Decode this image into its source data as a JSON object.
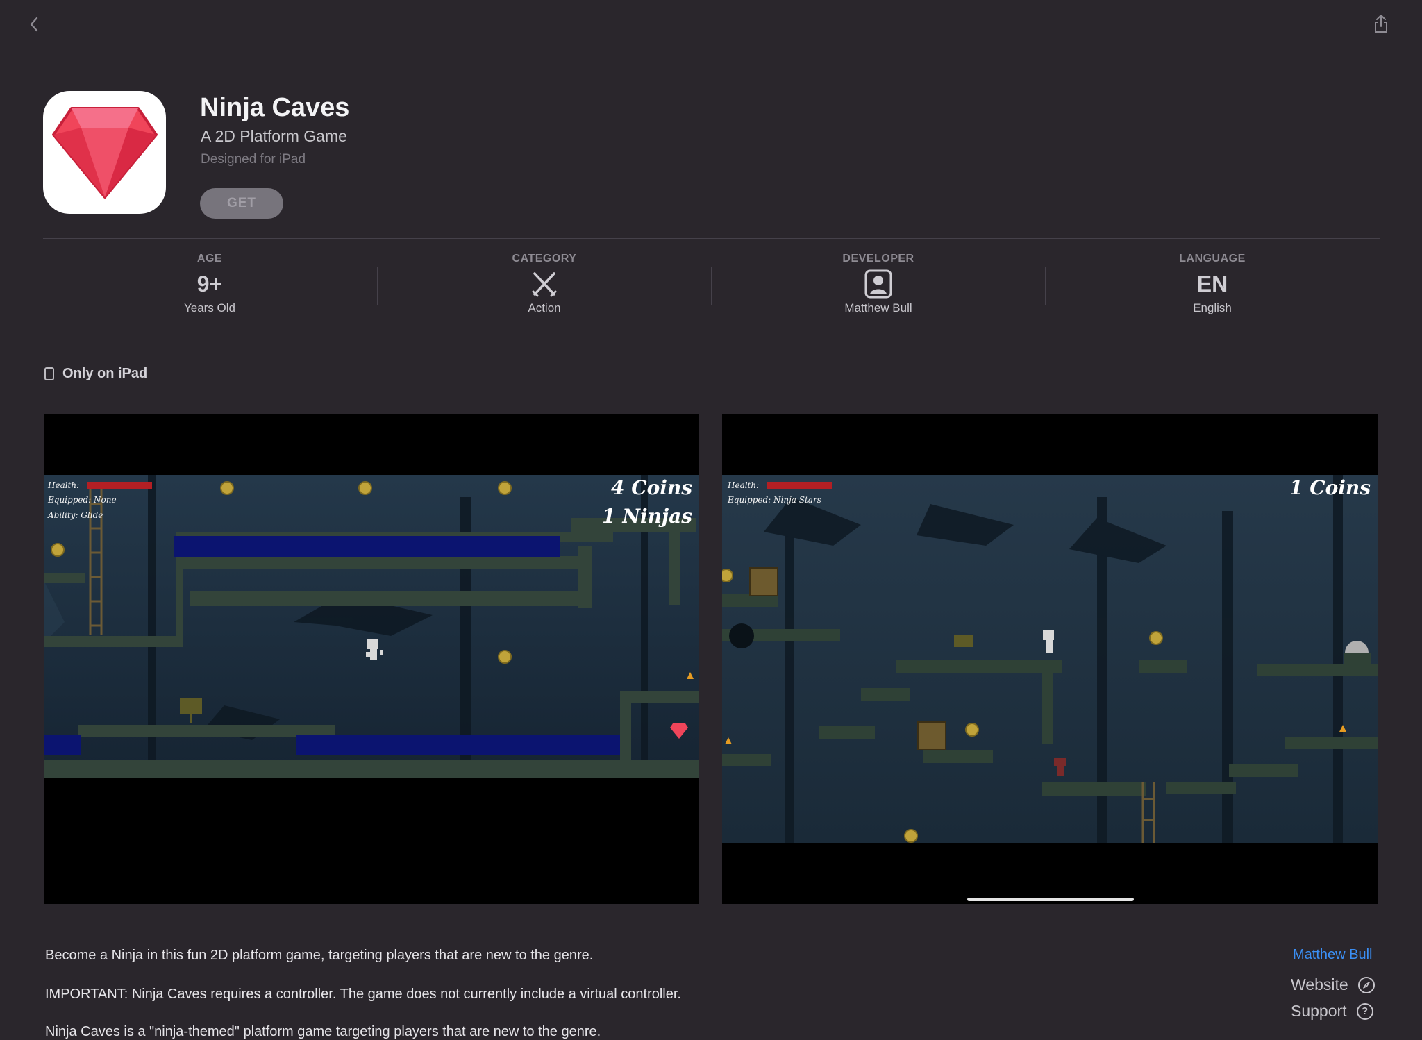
{
  "app": {
    "title": "Ninja Caves",
    "subtitle": "A 2D Platform Game",
    "designed_for": "Designed for iPad",
    "get_label": "GET"
  },
  "info": [
    {
      "label": "AGE",
      "value": "9+",
      "sub": "Years Old"
    },
    {
      "label": "CATEGORY",
      "icon": "swords-icon",
      "sub": "Action"
    },
    {
      "label": "DEVELOPER",
      "icon": "person-icon",
      "sub": "Matthew Bull"
    },
    {
      "label": "LANGUAGE",
      "value": "EN",
      "sub": "English"
    }
  ],
  "only_ipad": "Only on iPad",
  "screenshots": [
    {
      "hud": [
        "Health:",
        "Equipped: None",
        "Ability: Glide"
      ],
      "counters": [
        "4 Coins",
        "1 Ninjas"
      ]
    },
    {
      "hud": [
        "Health:",
        "Equipped: Ninja Stars"
      ],
      "counters": [
        "1 Coins"
      ]
    }
  ],
  "description": [
    "Become a Ninja in this fun 2D platform game, targeting players that are new to the genre.",
    "IMPORTANT: Ninja Caves requires a controller. The game does not currently include a virtual controller.",
    "Ninja Caves is a \"ninja-themed\" platform game targeting players that are new to the genre."
  ],
  "sidebar": {
    "developer": "Matthew Bull",
    "website": "Website",
    "support": "Support"
  },
  "colors": {
    "background": "#2a262c",
    "accent_link": "#3b8ff5",
    "gem": "#f0455a"
  }
}
